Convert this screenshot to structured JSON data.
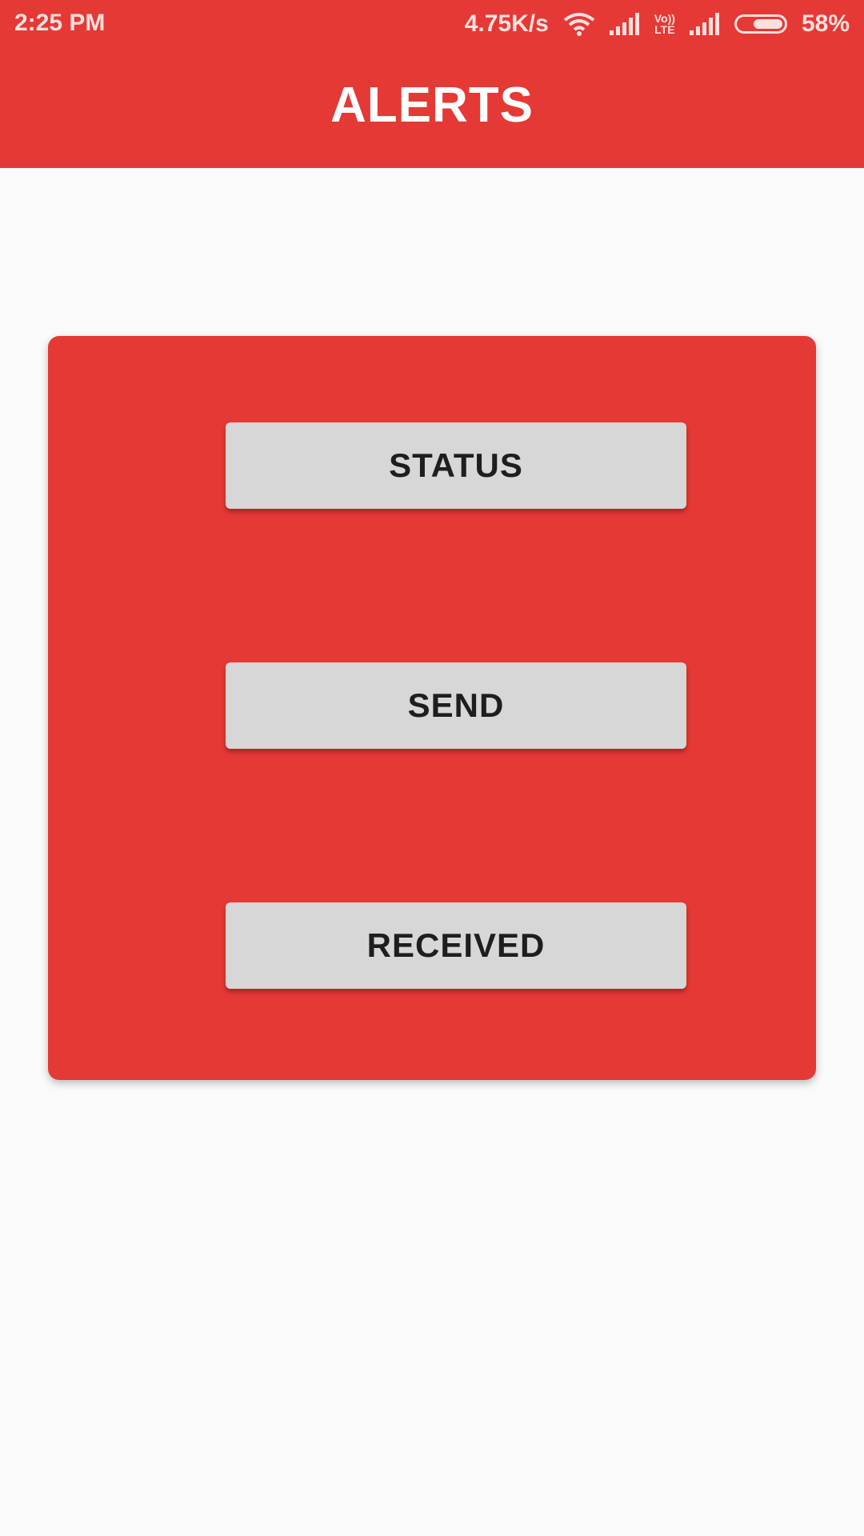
{
  "status_bar": {
    "time": "2:25 PM",
    "network_speed": "4.75K/s",
    "lte_top": "Vo))",
    "lte_bottom": "LTE",
    "battery": "58%",
    "icons": [
      "wifi-icon",
      "signal-icon",
      "volte-icon",
      "signal-icon",
      "battery-icon"
    ],
    "battery_level": 0.58
  },
  "header": {
    "title": "ALERTS"
  },
  "card": {
    "buttons": [
      {
        "label": "STATUS"
      },
      {
        "label": "SEND"
      },
      {
        "label": "RECEIVED"
      }
    ]
  },
  "colors": {
    "primary": "#e53935",
    "button_bg": "#d7d7d7",
    "background": "#fafafa"
  }
}
